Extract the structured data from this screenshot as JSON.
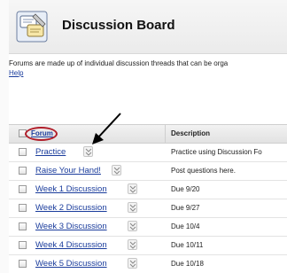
{
  "header": {
    "title": "Discussion Board",
    "icon": "discussion-board-icon"
  },
  "intro": {
    "text": "Forums are made up of individual discussion threads that can be orga",
    "help_link": "Help"
  },
  "table": {
    "columns": {
      "forum": "Forum",
      "description": "Description"
    },
    "rows": [
      {
        "name": "Practice",
        "description": "Practice using Discussion Fo"
      },
      {
        "name": "Raise Your Hand!",
        "description": "Post questions here."
      },
      {
        "name": "Week 1 Discussion",
        "description": "Due 9/20"
      },
      {
        "name": "Week 2 Discussion",
        "description": "Due 9/27"
      },
      {
        "name": "Week 3 Discussion",
        "description": "Due 10/4"
      },
      {
        "name": "Week 4 Discussion",
        "description": "Due 10/11"
      },
      {
        "name": "Week 5 Discussion",
        "description": "Due 10/18"
      }
    ]
  },
  "colors": {
    "link": "#1a3c9c",
    "highlight_circle": "#b01e2a"
  }
}
